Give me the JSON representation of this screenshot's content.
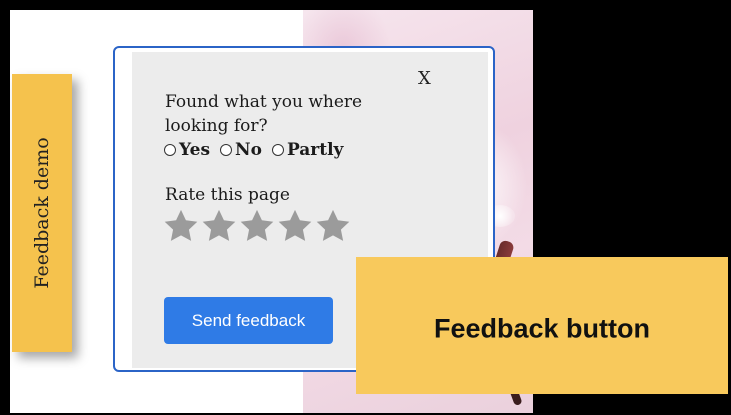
{
  "tab": {
    "label": "Feedback demo"
  },
  "dialog": {
    "close_label": "X",
    "question": "Found what you where looking for?",
    "options": [
      "Yes",
      "No",
      "Partly"
    ],
    "rating_title": "Rate this page",
    "rating": {
      "max": 5,
      "value": 0,
      "star_icon": "star-icon",
      "color": "#9b9b9b"
    },
    "send_label": "Send feedback",
    "accent": "#2f7be6",
    "frame_color": "#2b64c7"
  },
  "callout": {
    "label": "Feedback button",
    "color": "#f8c95c"
  }
}
